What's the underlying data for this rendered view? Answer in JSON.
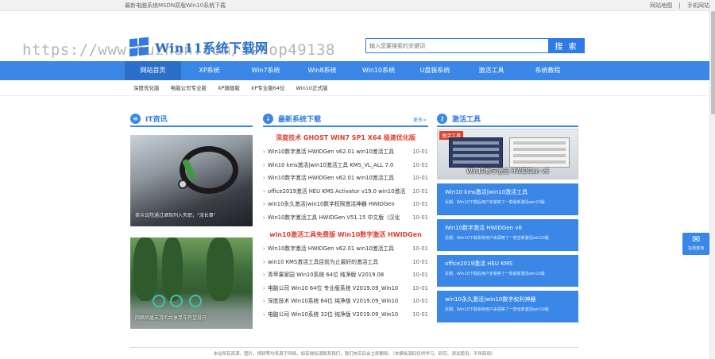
{
  "topbar": {
    "left_text": "最新电脑系统MSDN原版Win10系统下载",
    "links": [
      "网站地图",
      "|",
      "手机网站"
    ]
  },
  "watermark": "https://www.huzhan.com/ishop49138",
  "logo": {
    "text": "Win11系统下载网",
    "icon": "windows-logo-icon"
  },
  "search": {
    "placeholder": "输入您要搜索的关键词",
    "button": "搜 索"
  },
  "nav": {
    "items": [
      "网站首页",
      "XP系统",
      "Win7系统",
      "Win8系统",
      "Win10系统",
      "U盘装系统",
      "激活工具",
      "系统教程"
    ],
    "active_index": 0
  },
  "subnav": {
    "items": [
      "深度优化版",
      "电脑公司专业版",
      "XP旗舰版",
      "XP专业版64位",
      "Win10正式版"
    ]
  },
  "it_news": {
    "title": "IT资讯",
    "icon": "news-icon",
    "photos": [
      {
        "caption": "美众议院通过酒驾列入失职，\"流长事\""
      },
      {
        "caption": "网络后盾支持的共享单车有望投开"
      }
    ]
  },
  "latest": {
    "title": "最新系统下载",
    "icon": "download-icon",
    "more": "更多>",
    "groups": [
      {
        "headline": "深度技术 GHOST WIN7 SP1 X64 极速优化版",
        "items": [
          {
            "title": "Win10数字激活 HWIDGen v62.01 win10激活工具",
            "date": "10-01"
          },
          {
            "title": "Win10 kms激活|win10激活工具 KMS_VL_ALL 7.0",
            "date": "10-01"
          },
          {
            "title": "Win10数字激活 HWIDGen v62.01 win10激活工具",
            "date": "10-01"
          },
          {
            "title": "office2019激活 HEU KMS Activator v19.0 win10激活",
            "date": "10-01"
          },
          {
            "title": "win10永久激活|win10数字权限激活神器 HWIDGen",
            "date": "10-01"
          },
          {
            "title": "Win10数字激活工具 HWIDGen V51.15 中文版（汉化",
            "date": "10-01"
          }
        ]
      },
      {
        "headline": "win10激活工具免费版 Win10数字激活 HWIDGen",
        "items": [
          {
            "title": "Win10数字激活 HWIDGen v62.01 win10激活工具",
            "date": "10-01"
          },
          {
            "title": "win10 KMS激活工具目前为止最好的激活工具",
            "date": "10-01"
          },
          {
            "title": "青苹果家园 Win10系统 64位 纯净版 V2019.08",
            "date": "10-01"
          },
          {
            "title": "电脑公司 Win10 64位 专业版系统 V2019.09_Win10",
            "date": "10-01"
          },
          {
            "title": "深度技术 Win10系统 64位 纯净版 V2019.09_Win10",
            "date": "10-01"
          },
          {
            "title": "电脑公司 Win10系统 32位 纯净版 V2019.09_Win10",
            "date": "10-01"
          }
        ]
      }
    ]
  },
  "tools": {
    "title": "激活工具",
    "icon": "key-icon",
    "banner": {
      "tag": "激活工具",
      "caption": "Win10数字激活 HWIDGen v6"
    },
    "cards": [
      {
        "name": "Win10 kms激活|win10激活工具",
        "sub": "近期、Win10下载后用户安装等了一款最新激活win10版"
      },
      {
        "name": "Win10数字激活 HWIDGen v6",
        "sub": "近期、Win10下载系统用户来源等了一款全新激活win10版"
      },
      {
        "name": "office2019激活 HEU KMS",
        "sub": "近期、Win10下载后用户安装等了一款最新激活win10版"
      },
      {
        "name": "win10永久激活|win10数字权利神器",
        "sub": "近期、Win10下载系统用户来源等了一款全新激活win10版"
      }
    ]
  },
  "float_contact": {
    "icon": "wechat-icon",
    "label": "在线咨询"
  },
  "footer": {
    "text": "本站所有资源、图片、视频等均来源于网络，如有侵权请联系我们，我们核实后会立即删除。（本模板源码仅供学习、研究、测试使用，不得商用）"
  },
  "colors": {
    "primary": "#3a87e8",
    "nav_active": "#2a6fc9",
    "headline_red": "#e23a2e"
  }
}
